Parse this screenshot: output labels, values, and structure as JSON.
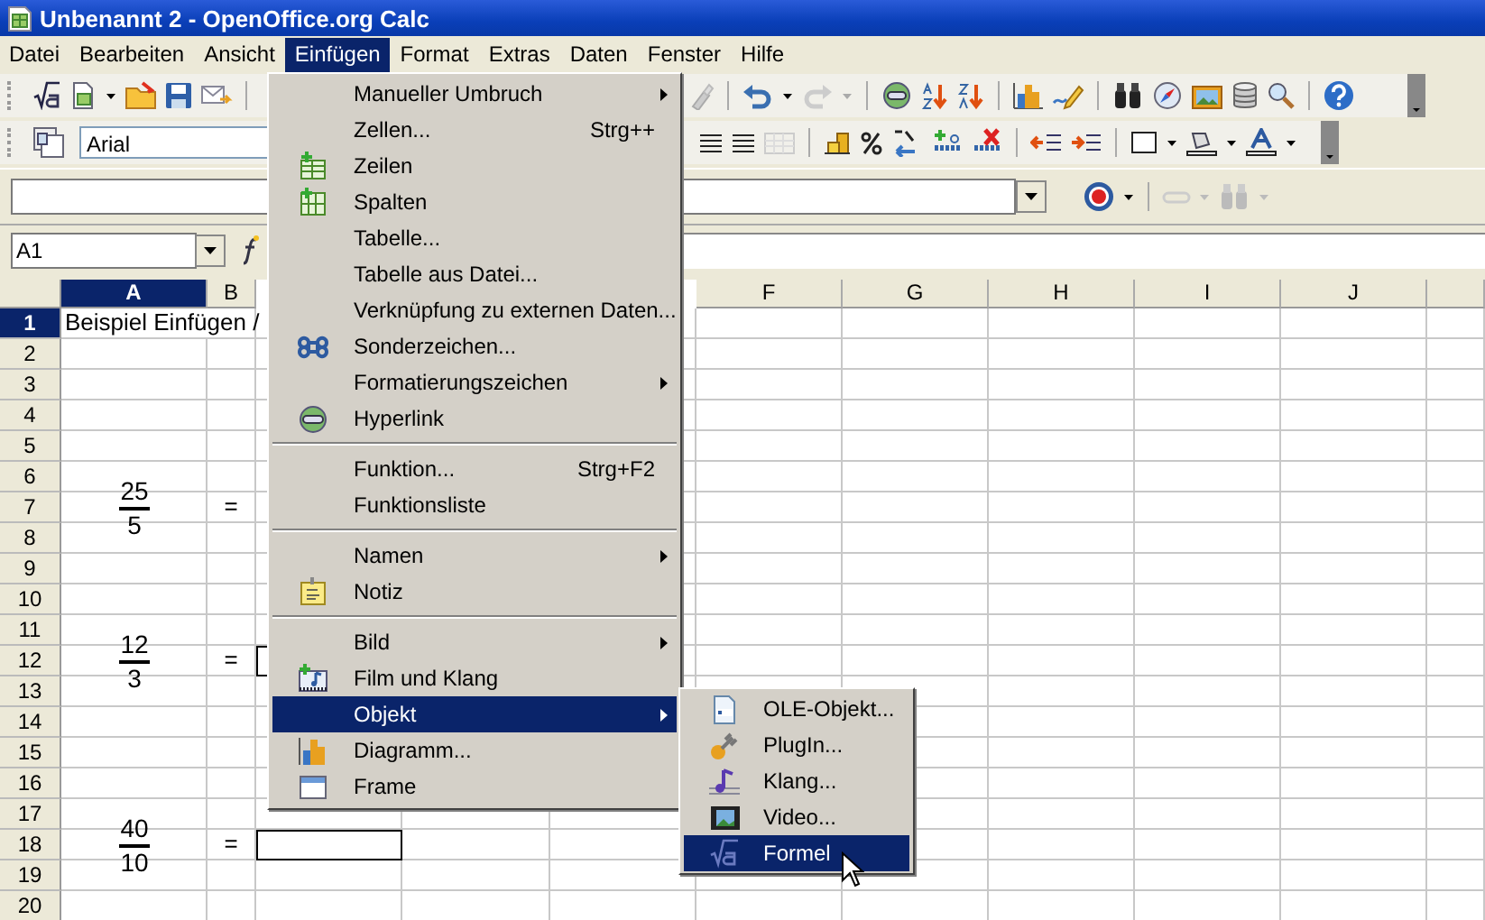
{
  "window": {
    "title": "Unbenannt 2 - OpenOffice.org Calc"
  },
  "menu_bar": [
    {
      "label": "Datei",
      "selected": false
    },
    {
      "label": "Bearbeiten",
      "selected": false
    },
    {
      "label": "Ansicht",
      "selected": false
    },
    {
      "label": "Einfügen",
      "selected": true
    },
    {
      "label": "Format",
      "selected": false
    },
    {
      "label": "Extras",
      "selected": false
    },
    {
      "label": "Daten",
      "selected": false
    },
    {
      "label": "Fenster",
      "selected": false
    },
    {
      "label": "Hilfe",
      "selected": false
    }
  ],
  "toolbar": {
    "font_name": "Arial"
  },
  "name_box": {
    "value": "A1"
  },
  "open_menu": {
    "items": [
      {
        "kind": "item",
        "label": "Manueller Umbruch",
        "submenu": true,
        "selected": false
      },
      {
        "kind": "item",
        "label": "Zellen...",
        "shortcut": "Strg++",
        "selected": false
      },
      {
        "kind": "item",
        "label": "Zeilen",
        "selected": false
      },
      {
        "kind": "item",
        "label": "Spalten",
        "selected": false
      },
      {
        "kind": "item",
        "label": "Tabelle...",
        "selected": false
      },
      {
        "kind": "item",
        "label": "Tabelle aus Datei...",
        "selected": false
      },
      {
        "kind": "item",
        "label": "Verknüpfung zu externen Daten...",
        "selected": false
      },
      {
        "kind": "item",
        "label": "Sonderzeichen...",
        "selected": false
      },
      {
        "kind": "item",
        "label": "Formatierungszeichen",
        "submenu": true,
        "selected": false
      },
      {
        "kind": "item",
        "label": "Hyperlink",
        "selected": false
      },
      {
        "kind": "separator"
      },
      {
        "kind": "item",
        "label": "Funktion...",
        "shortcut": "Strg+F2",
        "selected": false
      },
      {
        "kind": "item",
        "label": "Funktionsliste",
        "selected": false
      },
      {
        "kind": "separator"
      },
      {
        "kind": "item",
        "label": "Namen",
        "submenu": true,
        "selected": false
      },
      {
        "kind": "item",
        "label": "Notiz",
        "selected": false
      },
      {
        "kind": "separator"
      },
      {
        "kind": "item",
        "label": "Bild",
        "submenu": true,
        "selected": false
      },
      {
        "kind": "item",
        "label": "Film und Klang",
        "selected": false
      },
      {
        "kind": "item",
        "label": "Objekt",
        "submenu": true,
        "selected": true
      },
      {
        "kind": "item",
        "label": "Diagramm...",
        "selected": false
      },
      {
        "kind": "item",
        "label": "Frame",
        "selected": false
      }
    ]
  },
  "submenu": {
    "items": [
      {
        "label": "OLE-Objekt...",
        "selected": false
      },
      {
        "label": "PlugIn...",
        "selected": false
      },
      {
        "label": "Klang...",
        "selected": false
      },
      {
        "label": "Video...",
        "selected": false
      },
      {
        "label": "Formel",
        "selected": true
      }
    ]
  },
  "sheet": {
    "columns_left": [
      {
        "label": "A",
        "selected": true
      },
      {
        "label": "B",
        "selected": false
      }
    ],
    "columns_right": [
      {
        "label": "F",
        "selected": false
      },
      {
        "label": "G",
        "selected": false
      },
      {
        "label": "H",
        "selected": false
      },
      {
        "label": "I",
        "selected": false
      },
      {
        "label": "J",
        "selected": false
      }
    ],
    "rows": [
      {
        "number": "1",
        "selected": true,
        "col_a": {
          "kind": "text",
          "text": "Beispiel Einfügen /"
        }
      },
      {
        "number": "2",
        "selected": false
      },
      {
        "number": "3",
        "selected": false
      },
      {
        "number": "4",
        "selected": false
      },
      {
        "number": "5",
        "selected": false
      },
      {
        "number": "6",
        "selected": false
      },
      {
        "number": "7",
        "selected": false,
        "col_a": {
          "kind": "fraction",
          "numerator": "25",
          "denominator": "5"
        },
        "col_b": {
          "kind": "text",
          "text": "="
        }
      },
      {
        "number": "8",
        "selected": false
      },
      {
        "number": "9",
        "selected": false
      },
      {
        "number": "10",
        "selected": false
      },
      {
        "number": "11",
        "selected": false
      },
      {
        "number": "12",
        "selected": false,
        "col_a": {
          "kind": "fraction",
          "numerator": "12",
          "denominator": "3"
        },
        "col_b": {
          "kind": "text",
          "text": "="
        },
        "col_c": {
          "kind": "outlined"
        }
      },
      {
        "number": "13",
        "selected": false
      },
      {
        "number": "14",
        "selected": false
      },
      {
        "number": "15",
        "selected": false
      },
      {
        "number": "16",
        "selected": false
      },
      {
        "number": "17",
        "selected": false
      },
      {
        "number": "18",
        "selected": false,
        "col_a": {
          "kind": "fraction",
          "numerator": "40",
          "denominator": "10"
        },
        "col_b": {
          "kind": "text",
          "text": "="
        },
        "col_c": {
          "kind": "outlined"
        }
      },
      {
        "number": "19",
        "selected": false
      },
      {
        "number": "20",
        "selected": false
      }
    ]
  }
}
